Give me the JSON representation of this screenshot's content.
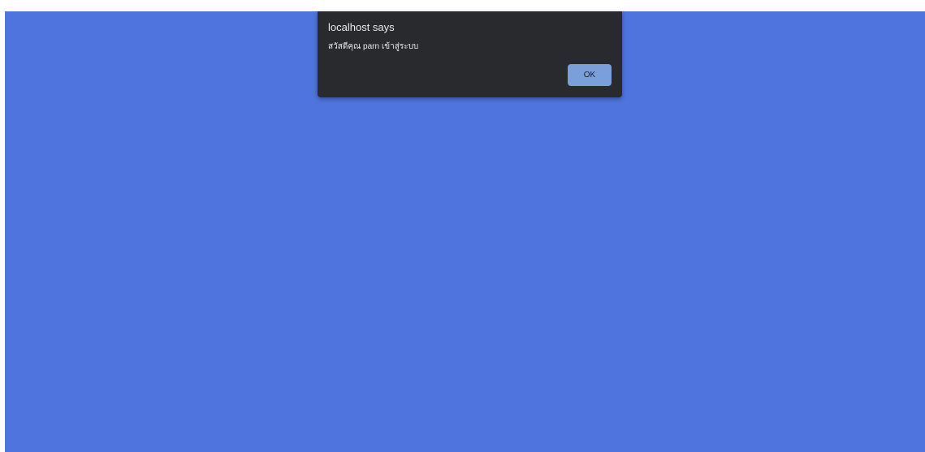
{
  "alert": {
    "title": "localhost says",
    "message": "สวัสดีคุณ parn เข้าสู่ระบบ",
    "ok_label": "OK"
  },
  "colors": {
    "page_background": "#4f74de",
    "dialog_background": "#292a2d",
    "ok_button": "#7b9fdb"
  }
}
